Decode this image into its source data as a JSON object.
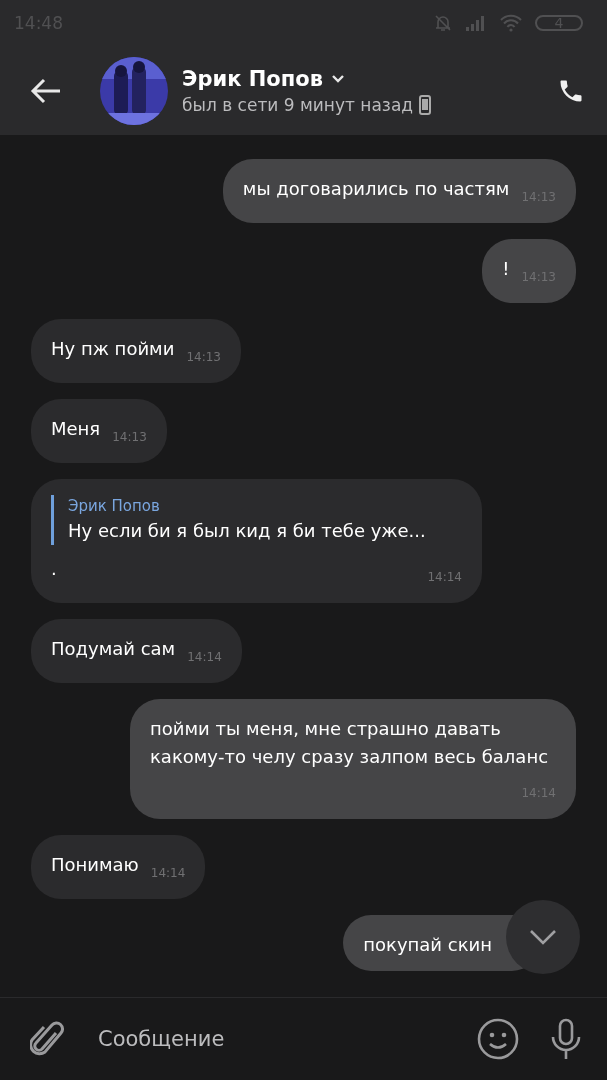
{
  "status_bar": {
    "time": "14:48",
    "battery": "4"
  },
  "header": {
    "name": "Эрик Попов",
    "status": "был в сети 9 минут назад"
  },
  "messages": [
    {
      "kind": "outgoing",
      "text": "мы договарились по частям",
      "time": "14:13"
    },
    {
      "kind": "outgoing",
      "text": "!",
      "time": "14:13"
    },
    {
      "kind": "incoming",
      "text": "Ну пж пойми",
      "time": "14:13"
    },
    {
      "kind": "incoming",
      "text": "Меня",
      "time": "14:13"
    },
    {
      "kind": "incoming",
      "text": ".",
      "time": "14:14",
      "reply": {
        "author": "Эрик Попов",
        "text": "Ну если би я был кид я би тебе уже..."
      }
    },
    {
      "kind": "incoming",
      "text": "Подумай сам",
      "time": "14:14"
    },
    {
      "kind": "outgoing",
      "text": "пойми ты меня, мне страшно давать какому-то челу сразу залпом весь баланс",
      "time": "14:14"
    },
    {
      "kind": "incoming",
      "text": "Понимаю",
      "time": "14:14"
    },
    {
      "kind": "outgoing",
      "text": "покупай скин"
    }
  ],
  "composer": {
    "placeholder": "Сообщение"
  }
}
